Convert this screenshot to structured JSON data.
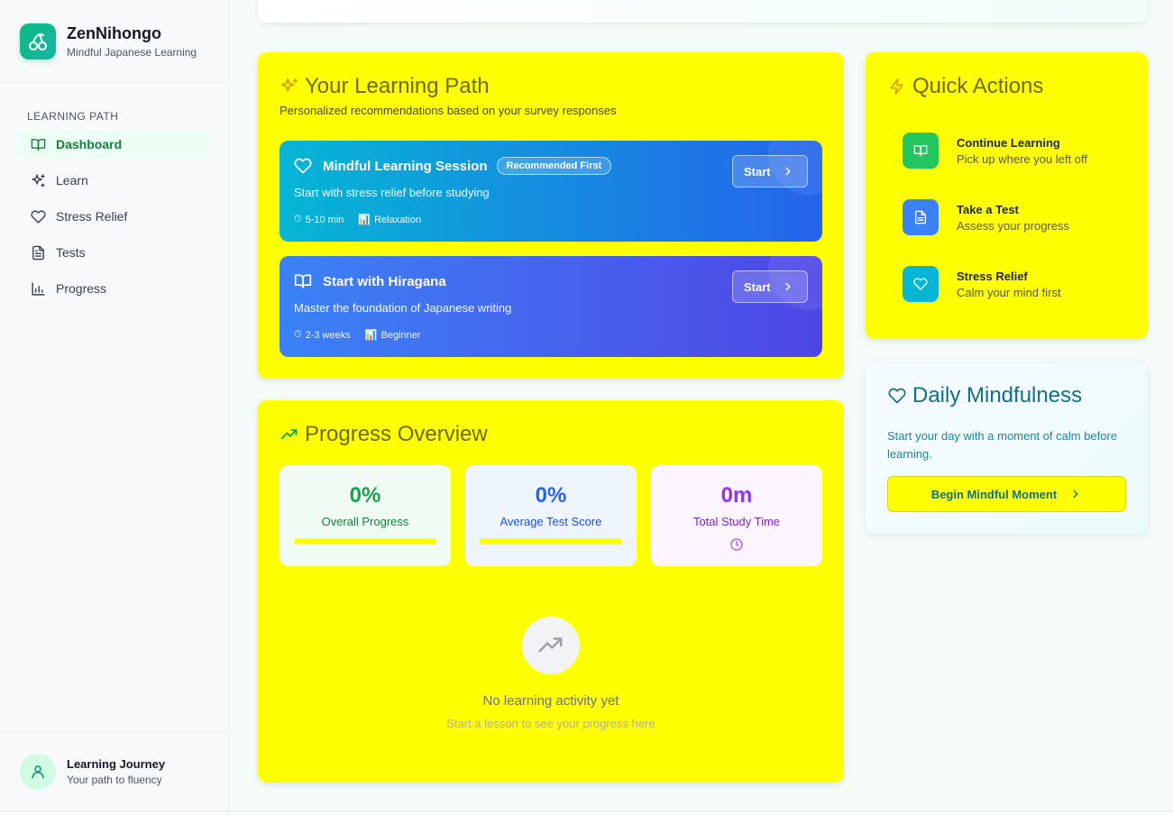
{
  "brand": {
    "name": "ZenNihongo",
    "tagline": "Mindful Japanese Learning"
  },
  "sidebar": {
    "section_label": "LEARNING PATH",
    "items": [
      {
        "label": "Dashboard",
        "icon": "book-open-icon",
        "active": true
      },
      {
        "label": "Learn",
        "icon": "sparkles-icon",
        "active": false
      },
      {
        "label": "Stress Relief",
        "icon": "heart-icon",
        "active": false
      },
      {
        "label": "Tests",
        "icon": "file-text-icon",
        "active": false
      },
      {
        "label": "Progress",
        "icon": "bar-chart-icon",
        "active": false
      }
    ],
    "footer": {
      "title": "Learning Journey",
      "subtitle": "Your path to fluency"
    }
  },
  "learning_path": {
    "title": "Your Learning Path",
    "subtitle": "Personalized recommendations based on your survey responses",
    "recommendations": [
      {
        "title": "Mindful Learning Session",
        "badge": "Recommended First",
        "description": "Start with stress relief before studying",
        "duration": "5-10 min",
        "category": "Relaxation",
        "button": "Start",
        "icon": "heart-icon"
      },
      {
        "title": "Start with Hiragana",
        "badge": "",
        "description": "Master the foundation of Japanese writing",
        "duration": "2-3 weeks",
        "category": "Beginner",
        "button": "Start",
        "icon": "book-open-icon"
      }
    ]
  },
  "progress_overview": {
    "title": "Progress Overview",
    "stats": [
      {
        "value": "0%",
        "label": "Overall Progress",
        "color": "#16a34a",
        "progress": 0
      },
      {
        "value": "0%",
        "label": "Average Test Score",
        "color": "#2563eb",
        "progress": 0
      },
      {
        "value": "0m",
        "label": "Total Study Time",
        "color": "#9333ea"
      }
    ],
    "empty_title": "No learning activity yet",
    "empty_subtitle": "Start a lesson to see your progress here"
  },
  "quick_actions": {
    "title": "Quick Actions",
    "items": [
      {
        "title": "Continue Learning",
        "subtitle": "Pick up where you left off",
        "color": "#22c55e",
        "icon": "book-open-icon"
      },
      {
        "title": "Take a Test",
        "subtitle": "Assess your progress",
        "color": "#3b82f6",
        "icon": "file-text-icon"
      },
      {
        "title": "Stress Relief",
        "subtitle": "Calm your mind first",
        "color": "#06b6d4",
        "icon": "heart-icon"
      }
    ]
  },
  "daily_mindfulness": {
    "title": "Daily Mindfulness",
    "description": "Start your day with a moment of calm before learning.",
    "button": "Begin Mindful Moment"
  },
  "colors": {
    "accent": "#10b981",
    "card_bg": "#ffff00"
  }
}
